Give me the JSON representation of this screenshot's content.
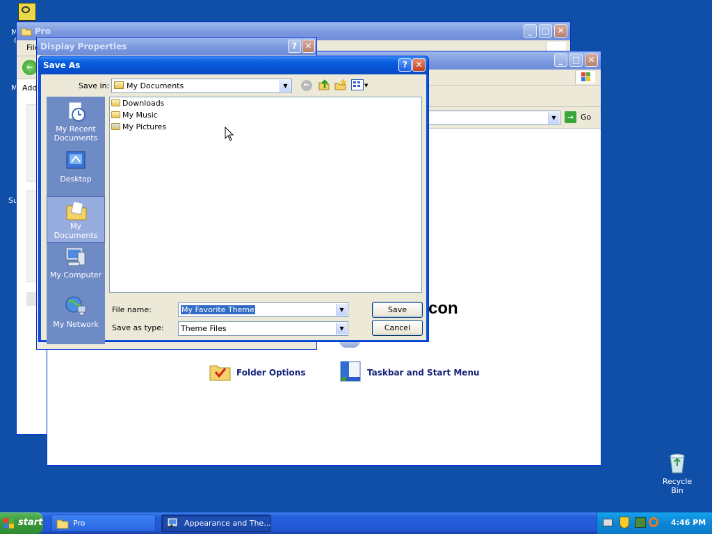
{
  "desktop": {
    "recycle_bin_label": "Recycle Bin",
    "clipped_icon_labels": [
      "M",
      "C"
    ],
    "left_edge_fragments": [
      "M",
      "Su"
    ]
  },
  "window_pro": {
    "title": "Pro",
    "menu_fragment": "File",
    "toolbar_fragment": "Add"
  },
  "window_display_properties": {
    "title": "Display Properties",
    "help_label": "?",
    "close_label": "✕"
  },
  "window_control_panel": {
    "go_label": "Go",
    "heading_fragment": "con",
    "tasks": [
      {
        "label": "Folder Options",
        "icon": "folder-check-icon"
      },
      {
        "label": "Taskbar and Start Menu",
        "icon": "taskbar-icon"
      }
    ]
  },
  "save_as": {
    "title": "Save As",
    "help_label": "?",
    "close_label": "✕",
    "save_in_label": "Save in:",
    "save_in_value": "My Documents",
    "places": [
      {
        "label": "My Recent Documents",
        "icon": "recent-documents-icon",
        "selected": false
      },
      {
        "label": "Desktop",
        "icon": "desktop-icon",
        "selected": false
      },
      {
        "label": "My Documents",
        "icon": "my-documents-icon",
        "selected": true
      },
      {
        "label": "My Computer",
        "icon": "my-computer-icon",
        "selected": false
      },
      {
        "label": "My Network",
        "icon": "my-network-icon",
        "selected": false
      }
    ],
    "files": [
      {
        "name": "Downloads",
        "icon": "folder-icon"
      },
      {
        "name": "My Music",
        "icon": "music-folder-icon"
      },
      {
        "name": "My Pictures",
        "icon": "pictures-folder-icon"
      }
    ],
    "file_name_label": "File name:",
    "file_name_value": "My Favorite Theme",
    "save_as_type_label": "Save as type:",
    "save_as_type_value": "Theme Files",
    "save_button": "Save",
    "cancel_button": "Cancel"
  },
  "taskbar": {
    "start_label": "start",
    "tasks": [
      {
        "label": "Pro",
        "active": false
      },
      {
        "label": "Appearance and The...",
        "active": true
      }
    ],
    "clock": "4:46 PM"
  },
  "colors": {
    "desktop": "#0f4fa8",
    "titlebar_active": "#0a5fde",
    "titlebar_inactive": "#7a96df",
    "dialog_face": "#ece9d8",
    "selection": "#316ac5",
    "start_button": "#3c9a3c"
  }
}
